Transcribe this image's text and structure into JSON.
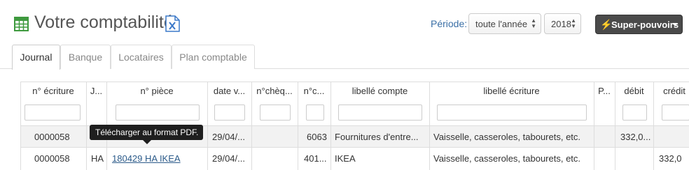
{
  "header": {
    "title": "Votre comptabilité",
    "periode_label": "Période:",
    "period_select": "toute l'année",
    "year_select": "2018",
    "super_button": "Super-pouvoirs"
  },
  "tabs": [
    {
      "label": "Journal",
      "active": true
    },
    {
      "label": "Banque"
    },
    {
      "label": "Locataires"
    },
    {
      "label": "Plan comptable"
    }
  ],
  "table": {
    "columns": [
      "n° écriture",
      "J...",
      "n° pièce",
      "date v...",
      "n°chèq...",
      "n°c...",
      "libellé compte",
      "libellé écriture",
      "P...",
      "débit",
      "crédit"
    ],
    "rows": [
      {
        "ecriture": "0000058",
        "journal": "HA",
        "piece": "",
        "date": "29/04/...",
        "cheque": "",
        "compte": "6063",
        "libelle_compte": "Fournitures d'entre...",
        "libelle_ecriture": "Vaisselle, casseroles, tabourets, etc.",
        "debit": "332,0...",
        "credit": ""
      },
      {
        "ecriture": "0000058",
        "journal": "HA",
        "piece": "180429 HA IKEA",
        "date": "29/04/...",
        "cheque": "",
        "compte": "401...",
        "libelle_compte": "IKEA",
        "libelle_ecriture": "Vaisselle, casseroles, tabourets, etc.",
        "debit": "",
        "credit": "332,0"
      }
    ]
  },
  "tooltip": "Télécharger au format PDF.",
  "colors": {
    "accent": "#3a6fa6",
    "button_dark": "#4a4a4a",
    "icon_green": "#3f9a3f"
  }
}
